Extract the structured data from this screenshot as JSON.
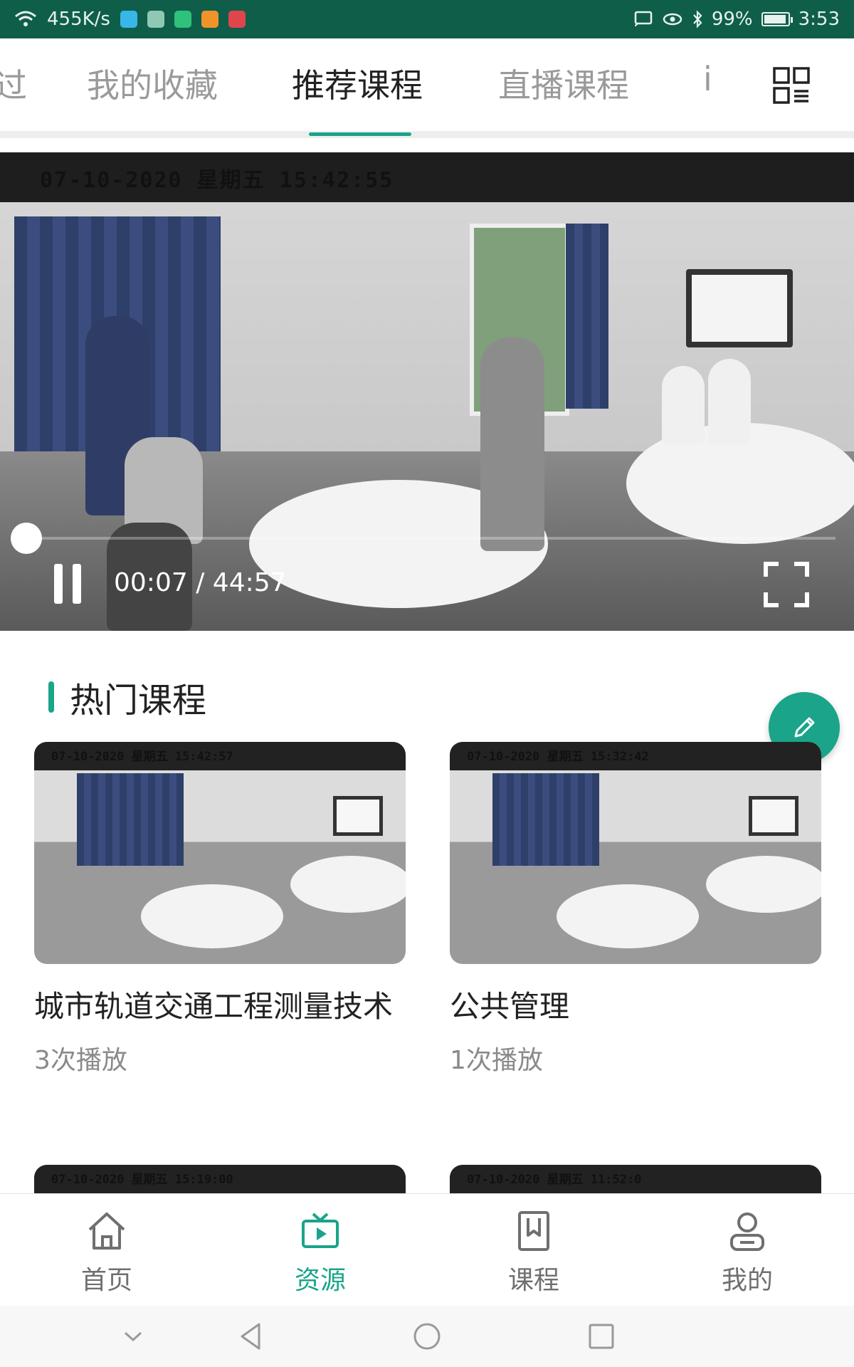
{
  "status_bar": {
    "net_speed": "455K/s",
    "battery": "99%",
    "time": "3:53"
  },
  "top_tabs": {
    "items": [
      {
        "label": "过"
      },
      {
        "label": "我的收藏"
      },
      {
        "label": "推荐课程"
      },
      {
        "label": "直播课程"
      },
      {
        "label": "i"
      }
    ],
    "active_index": 2
  },
  "video": {
    "timestamp_overlay": "07-10-2020 星期五 15:42:55",
    "current_time": "00:07",
    "separator": "/",
    "duration": "44:57",
    "progress_fraction": 0.003
  },
  "section": {
    "title": "热门课程"
  },
  "courses": [
    {
      "title": "城市轨道交通工程测量技术",
      "plays": "3次播放",
      "thumb_ts": "07-10-2020 星期五 15:42:57"
    },
    {
      "title": "公共管理",
      "plays": "1次播放",
      "thumb_ts": "07-10-2020 星期五 15:32:42"
    },
    {
      "title": "",
      "plays": "",
      "thumb_ts": "07-10-2020 星期五 15:19:00"
    },
    {
      "title": "",
      "plays": "",
      "thumb_ts": "07-10-2020 星期五 11:52:0"
    }
  ],
  "bottom_nav": {
    "items": [
      {
        "label": "首页",
        "icon": "home-icon"
      },
      {
        "label": "资源",
        "icon": "tv-icon"
      },
      {
        "label": "课程",
        "icon": "bookmark-book-icon"
      },
      {
        "label": "我的",
        "icon": "user-icon"
      }
    ],
    "active_index": 1
  },
  "colors": {
    "accent": "#1aa489",
    "status_bar": "#0f5e4a"
  }
}
